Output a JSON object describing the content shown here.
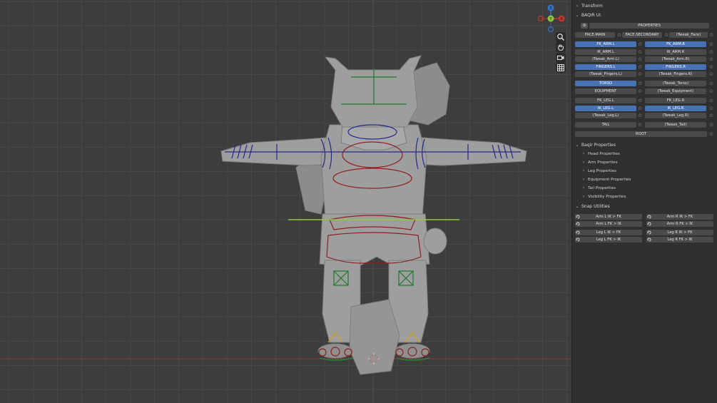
{
  "colors": {
    "accent": "#4772b3",
    "button": "#4a4a4a",
    "panel": "#303030",
    "viewport": "#3d3d3d",
    "rig_red": "#8e1f1f",
    "rig_blue": "#23288e",
    "rig_green": "#1d7a2c",
    "axis_x": "#c0392b",
    "axis_y": "#8dc63f",
    "axis_z": "#2e74c9"
  },
  "gizmo": {
    "z": "Z",
    "y": "Y",
    "x": "X"
  },
  "panel": {
    "transform": "Transform",
    "ui_title": "BAQIR UI",
    "properties_label": "PROPERTIES",
    "face_main": "FACE-MAIN",
    "face_secondary": "FACE-SECONDARY",
    "tweak_face": "(Tweak_Face)",
    "rows": [
      {
        "left": "FK_ARM.L",
        "left_active": true,
        "right": "FK_ARM.R",
        "right_active": true
      },
      {
        "left": "IK_ARM.L",
        "left_active": false,
        "right": "IK_ARM.R",
        "right_active": false
      },
      {
        "left": "(Tweak_Arm.L)",
        "left_active": false,
        "right": "(Tweak_Arm.R)",
        "right_active": false
      },
      {
        "left": "FINGERS.L",
        "left_active": true,
        "right": "FINGERS.R",
        "right_active": true
      },
      {
        "left": "(Tweak_Fingers.L)",
        "left_active": false,
        "right": "(Tweak_Fingers.R)",
        "right_active": false
      },
      {
        "left": "TORSO",
        "left_active": true,
        "right": "(Tweak_Torso)",
        "right_active": false
      },
      {
        "left": "EQUIPMENT",
        "left_active": false,
        "right": "(Tweak_Equipment)",
        "right_active": false
      },
      {
        "left": "FK_LEG.L",
        "left_active": false,
        "right": "FK_LEG.R",
        "right_active": false
      },
      {
        "left": "IK_LEG.L",
        "left_active": true,
        "right": "IK_LEG.R",
        "right_active": true
      },
      {
        "left": "(Tweak_Leg.L)",
        "left_active": false,
        "right": "(Tweak_Leg.R)",
        "right_active": false
      },
      {
        "left": "TAIL",
        "left_active": false,
        "right": "(Tweak_Tail)",
        "right_active": false
      }
    ],
    "root": "ROOT",
    "baqir_properties": "Baqir Properties",
    "sub_items": [
      "Head Properties",
      "Arm Properties",
      "Leg Properties",
      "Equipment Properties",
      "Tail Properties",
      "Visibility Properties"
    ],
    "snap_utilities": "Snap Utilities",
    "snap_rows": [
      {
        "left": "Arm L IK > FK",
        "right": "Arm R IK > FK"
      },
      {
        "left": "Arm L FK > IK",
        "right": "Arm R FK > IK"
      },
      {
        "left": "Leg L IK > FK",
        "right": "Leg R IK > FK"
      },
      {
        "left": "Leg L FK > IK",
        "right": "Leg R FK > IK"
      }
    ]
  }
}
